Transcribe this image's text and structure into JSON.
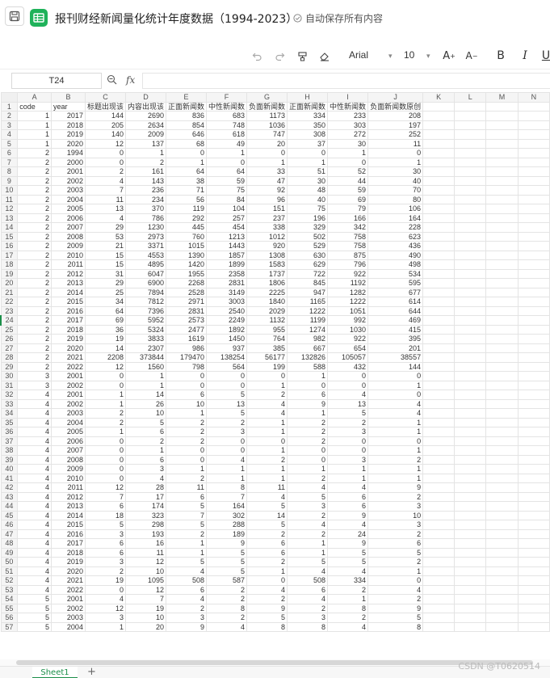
{
  "header": {
    "title": "报刊财经新闻量化统计年度数据（1994-2023）",
    "autosave": "自动保存所有内容"
  },
  "toolbar": {
    "font_name": "Arial",
    "font_size": "10",
    "bold": "B",
    "italic": "I",
    "underline": "U"
  },
  "formula_bar": {
    "cell_ref": "T24",
    "fx": "fx",
    "value": ""
  },
  "grid": {
    "columns": [
      "A",
      "B",
      "C",
      "D",
      "E",
      "F",
      "G",
      "H",
      "I",
      "J",
      "K",
      "L",
      "M",
      "N"
    ],
    "selected_row": 24,
    "rows": [
      {
        "n": 1,
        "c": [
          "code",
          "year",
          "标题出现该",
          "内容出现该",
          "正面新闻数",
          "中性新闻数",
          "负面新闻数",
          "正面新闻数",
          "中性新闻数",
          "负面新闻数原创"
        ]
      },
      {
        "n": 2,
        "c": [
          "1",
          "2017",
          "144",
          "2690",
          "836",
          "683",
          "1173",
          "334",
          "233",
          "208"
        ]
      },
      {
        "n": 3,
        "c": [
          "1",
          "2018",
          "205",
          "2634",
          "854",
          "748",
          "1036",
          "350",
          "303",
          "197"
        ]
      },
      {
        "n": 4,
        "c": [
          "1",
          "2019",
          "140",
          "2009",
          "646",
          "618",
          "747",
          "308",
          "272",
          "252"
        ]
      },
      {
        "n": 5,
        "c": [
          "1",
          "2020",
          "12",
          "137",
          "68",
          "49",
          "20",
          "37",
          "30",
          "11"
        ]
      },
      {
        "n": 6,
        "c": [
          "2",
          "1994",
          "0",
          "1",
          "0",
          "1",
          "0",
          "0",
          "1",
          "0"
        ]
      },
      {
        "n": 7,
        "c": [
          "2",
          "2000",
          "0",
          "2",
          "1",
          "0",
          "1",
          "1",
          "0",
          "1"
        ]
      },
      {
        "n": 8,
        "c": [
          "2",
          "2001",
          "2",
          "161",
          "64",
          "64",
          "33",
          "51",
          "52",
          "30"
        ]
      },
      {
        "n": 9,
        "c": [
          "2",
          "2002",
          "4",
          "143",
          "38",
          "59",
          "47",
          "30",
          "44",
          "40"
        ]
      },
      {
        "n": 10,
        "c": [
          "2",
          "2003",
          "7",
          "236",
          "71",
          "75",
          "92",
          "48",
          "59",
          "70"
        ]
      },
      {
        "n": 11,
        "c": [
          "2",
          "2004",
          "11",
          "234",
          "56",
          "84",
          "96",
          "40",
          "69",
          "80"
        ]
      },
      {
        "n": 12,
        "c": [
          "2",
          "2005",
          "13",
          "370",
          "119",
          "104",
          "151",
          "75",
          "79",
          "106"
        ]
      },
      {
        "n": 13,
        "c": [
          "2",
          "2006",
          "4",
          "786",
          "292",
          "257",
          "237",
          "196",
          "166",
          "164"
        ]
      },
      {
        "n": 14,
        "c": [
          "2",
          "2007",
          "29",
          "1230",
          "445",
          "454",
          "338",
          "329",
          "342",
          "228"
        ]
      },
      {
        "n": 15,
        "c": [
          "2",
          "2008",
          "53",
          "2973",
          "760",
          "1213",
          "1012",
          "502",
          "758",
          "623"
        ]
      },
      {
        "n": 16,
        "c": [
          "2",
          "2009",
          "21",
          "3371",
          "1015",
          "1443",
          "920",
          "529",
          "758",
          "436"
        ]
      },
      {
        "n": 17,
        "c": [
          "2",
          "2010",
          "15",
          "4553",
          "1390",
          "1857",
          "1308",
          "630",
          "875",
          "490"
        ]
      },
      {
        "n": 18,
        "c": [
          "2",
          "2011",
          "15",
          "4895",
          "1420",
          "1899",
          "1583",
          "629",
          "796",
          "498"
        ]
      },
      {
        "n": 19,
        "c": [
          "2",
          "2012",
          "31",
          "6047",
          "1955",
          "2358",
          "1737",
          "722",
          "922",
          "534"
        ]
      },
      {
        "n": 20,
        "c": [
          "2",
          "2013",
          "29",
          "6900",
          "2268",
          "2831",
          "1806",
          "845",
          "1192",
          "595"
        ]
      },
      {
        "n": 21,
        "c": [
          "2",
          "2014",
          "25",
          "7894",
          "2528",
          "3149",
          "2225",
          "947",
          "1282",
          "677"
        ]
      },
      {
        "n": 22,
        "c": [
          "2",
          "2015",
          "34",
          "7812",
          "2971",
          "3003",
          "1840",
          "1165",
          "1222",
          "614"
        ]
      },
      {
        "n": 23,
        "c": [
          "2",
          "2016",
          "64",
          "7396",
          "2831",
          "2540",
          "2029",
          "1222",
          "1051",
          "644"
        ]
      },
      {
        "n": 24,
        "c": [
          "2",
          "2017",
          "69",
          "5952",
          "2573",
          "2249",
          "1132",
          "1199",
          "992",
          "469"
        ]
      },
      {
        "n": 25,
        "c": [
          "2",
          "2018",
          "36",
          "5324",
          "2477",
          "1892",
          "955",
          "1274",
          "1030",
          "415"
        ]
      },
      {
        "n": 26,
        "c": [
          "2",
          "2019",
          "19",
          "3833",
          "1619",
          "1450",
          "764",
          "982",
          "922",
          "395"
        ]
      },
      {
        "n": 27,
        "c": [
          "2",
          "2020",
          "14",
          "2307",
          "986",
          "937",
          "385",
          "667",
          "654",
          "201"
        ]
      },
      {
        "n": 28,
        "c": [
          "2",
          "2021",
          "2208",
          "373844",
          "179470",
          "138254",
          "56177",
          "132826",
          "105057",
          "38557"
        ]
      },
      {
        "n": 29,
        "c": [
          "2",
          "2022",
          "12",
          "1560",
          "798",
          "564",
          "199",
          "588",
          "432",
          "144"
        ]
      },
      {
        "n": 30,
        "c": [
          "3",
          "2001",
          "0",
          "1",
          "0",
          "0",
          "0",
          "1",
          "0",
          "0"
        ]
      },
      {
        "n": 31,
        "c": [
          "3",
          "2002",
          "0",
          "1",
          "0",
          "0",
          "1",
          "0",
          "0",
          "1"
        ]
      },
      {
        "n": 32,
        "c": [
          "4",
          "2001",
          "1",
          "14",
          "6",
          "5",
          "2",
          "6",
          "4",
          "0"
        ]
      },
      {
        "n": 33,
        "c": [
          "4",
          "2002",
          "1",
          "26",
          "10",
          "13",
          "4",
          "9",
          "13",
          "4"
        ]
      },
      {
        "n": 34,
        "c": [
          "4",
          "2003",
          "2",
          "10",
          "1",
          "5",
          "4",
          "1",
          "5",
          "4"
        ]
      },
      {
        "n": 35,
        "c": [
          "4",
          "2004",
          "2",
          "5",
          "2",
          "2",
          "1",
          "2",
          "2",
          "1"
        ]
      },
      {
        "n": 36,
        "c": [
          "4",
          "2005",
          "1",
          "6",
          "2",
          "3",
          "1",
          "2",
          "3",
          "1"
        ]
      },
      {
        "n": 37,
        "c": [
          "4",
          "2006",
          "0",
          "2",
          "2",
          "0",
          "0",
          "2",
          "0",
          "0"
        ]
      },
      {
        "n": 38,
        "c": [
          "4",
          "2007",
          "0",
          "1",
          "0",
          "0",
          "1",
          "0",
          "0",
          "1"
        ]
      },
      {
        "n": 39,
        "c": [
          "4",
          "2008",
          "0",
          "6",
          "0",
          "4",
          "2",
          "0",
          "3",
          "2"
        ]
      },
      {
        "n": 40,
        "c": [
          "4",
          "2009",
          "0",
          "3",
          "1",
          "1",
          "1",
          "1",
          "1",
          "1"
        ]
      },
      {
        "n": 41,
        "c": [
          "4",
          "2010",
          "0",
          "4",
          "2",
          "1",
          "1",
          "2",
          "1",
          "1"
        ]
      },
      {
        "n": 42,
        "c": [
          "4",
          "2011",
          "12",
          "28",
          "11",
          "8",
          "11",
          "4",
          "4",
          "9"
        ]
      },
      {
        "n": 43,
        "c": [
          "4",
          "2012",
          "7",
          "17",
          "6",
          "7",
          "4",
          "5",
          "6",
          "2"
        ]
      },
      {
        "n": 44,
        "c": [
          "4",
          "2013",
          "6",
          "174",
          "5",
          "164",
          "5",
          "3",
          "6",
          "3"
        ]
      },
      {
        "n": 45,
        "c": [
          "4",
          "2014",
          "18",
          "323",
          "7",
          "302",
          "14",
          "2",
          "9",
          "10"
        ]
      },
      {
        "n": 46,
        "c": [
          "4",
          "2015",
          "5",
          "298",
          "5",
          "288",
          "5",
          "4",
          "4",
          "3"
        ]
      },
      {
        "n": 47,
        "c": [
          "4",
          "2016",
          "3",
          "193",
          "2",
          "189",
          "2",
          "2",
          "24",
          "2"
        ]
      },
      {
        "n": 48,
        "c": [
          "4",
          "2017",
          "6",
          "16",
          "1",
          "9",
          "6",
          "1",
          "9",
          "6"
        ]
      },
      {
        "n": 49,
        "c": [
          "4",
          "2018",
          "6",
          "11",
          "1",
          "5",
          "6",
          "1",
          "5",
          "5"
        ]
      },
      {
        "n": 50,
        "c": [
          "4",
          "2019",
          "3",
          "12",
          "5",
          "5",
          "2",
          "5",
          "5",
          "2"
        ]
      },
      {
        "n": 51,
        "c": [
          "4",
          "2020",
          "2",
          "10",
          "4",
          "5",
          "1",
          "4",
          "4",
          "1"
        ]
      },
      {
        "n": 52,
        "c": [
          "4",
          "2021",
          "19",
          "1095",
          "508",
          "587",
          "0",
          "508",
          "334",
          "0"
        ]
      },
      {
        "n": 53,
        "c": [
          "4",
          "2022",
          "0",
          "12",
          "6",
          "2",
          "4",
          "6",
          "2",
          "4"
        ]
      },
      {
        "n": 54,
        "c": [
          "5",
          "2001",
          "4",
          "7",
          "4",
          "2",
          "2",
          "4",
          "1",
          "2"
        ]
      },
      {
        "n": 55,
        "c": [
          "5",
          "2002",
          "12",
          "19",
          "2",
          "8",
          "9",
          "2",
          "8",
          "9"
        ]
      },
      {
        "n": 56,
        "c": [
          "5",
          "2003",
          "3",
          "10",
          "3",
          "2",
          "5",
          "3",
          "2",
          "5"
        ]
      },
      {
        "n": 57,
        "c": [
          "5",
          "2004",
          "1",
          "20",
          "9",
          "4",
          "8",
          "8",
          "4",
          "8"
        ]
      }
    ]
  },
  "sheets": {
    "tabs": [
      "Sheet1"
    ],
    "add_label": "+"
  },
  "watermark": "CSDN @T0620514"
}
